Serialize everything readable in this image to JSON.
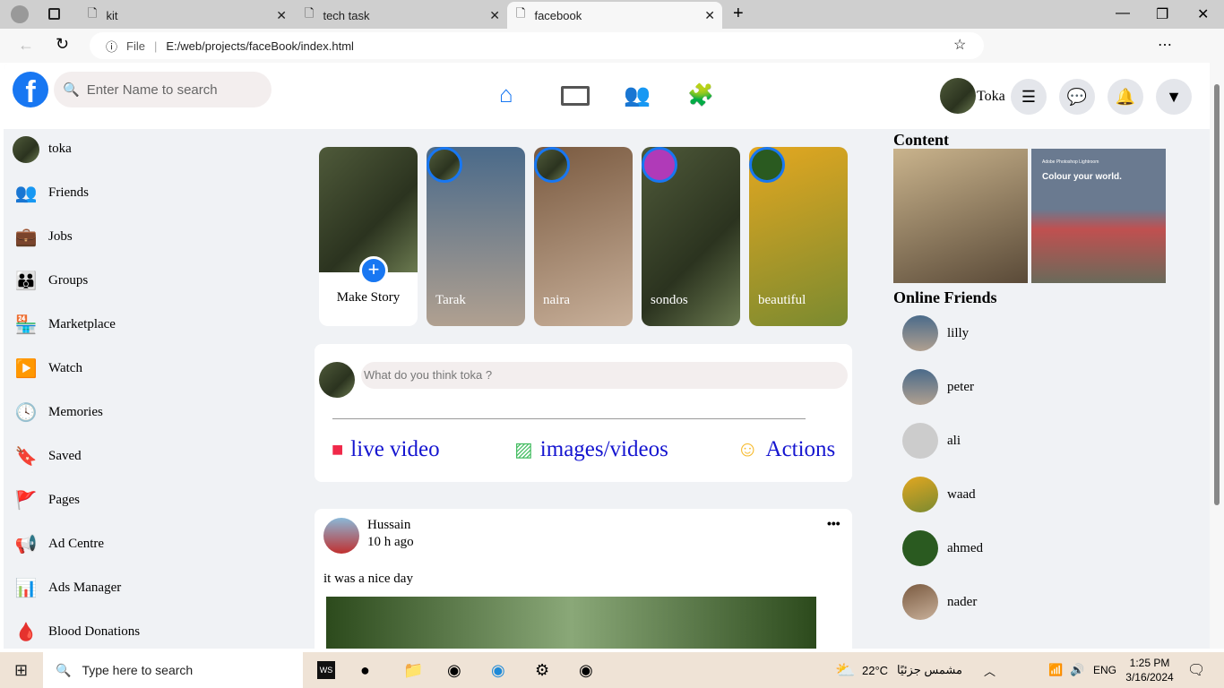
{
  "browser": {
    "tabs": [
      {
        "title": "kit"
      },
      {
        "title": "tech task"
      },
      {
        "title": "facebook"
      }
    ],
    "url_label": "File",
    "url": "E:/web/projects/faceBook/index.html"
  },
  "header": {
    "search_placeholder": "Enter Name to search",
    "user": "Toka",
    "brand_color": "#1877f2"
  },
  "sidebar": {
    "items": [
      {
        "label": "toka",
        "icon": "avatar"
      },
      {
        "label": "Friends",
        "icon": "friends-icon"
      },
      {
        "label": "Jobs",
        "icon": "briefcase-icon"
      },
      {
        "label": "Groups",
        "icon": "groups-icon"
      },
      {
        "label": "Marketplace",
        "icon": "store-icon"
      },
      {
        "label": "Watch",
        "icon": "play-icon"
      },
      {
        "label": "Memories",
        "icon": "clock-icon"
      },
      {
        "label": "Saved",
        "icon": "bookmark-icon"
      },
      {
        "label": "Pages",
        "icon": "flag-icon"
      },
      {
        "label": "Ad Centre",
        "icon": "megaphone-icon"
      },
      {
        "label": "Ads Manager",
        "icon": "chart-icon"
      },
      {
        "label": "Blood Donations",
        "icon": "drop-icon"
      }
    ]
  },
  "stories": [
    {
      "label": "Make Story"
    },
    {
      "label": "Tarak"
    },
    {
      "label": "naira"
    },
    {
      "label": "sondos"
    },
    {
      "label": "beautiful"
    }
  ],
  "composer": {
    "placeholder": "What do you think toka ?",
    "actions": [
      {
        "label": "live video"
      },
      {
        "label": "images/videos"
      },
      {
        "label": "Actions"
      }
    ]
  },
  "post": {
    "author": "Hussain",
    "time": "10 h ago",
    "text": "it was a nice day",
    "more": "•••"
  },
  "right": {
    "content_title": "Content",
    "ad_text": "Colour your world.",
    "ad_brand": "Adobe Photoshop Lightroom",
    "online_title": "Online Friends",
    "friends": [
      {
        "name": "lilly"
      },
      {
        "name": "peter"
      },
      {
        "name": "ali"
      },
      {
        "name": "waad"
      },
      {
        "name": "ahmed"
      },
      {
        "name": "nader"
      }
    ]
  },
  "taskbar": {
    "search_placeholder": "Type here to search",
    "weather": "22°C",
    "weather_desc": "مشمس جزئيًا",
    "lang": "ENG",
    "time": "1:25 PM",
    "date": "3/16/2024"
  }
}
